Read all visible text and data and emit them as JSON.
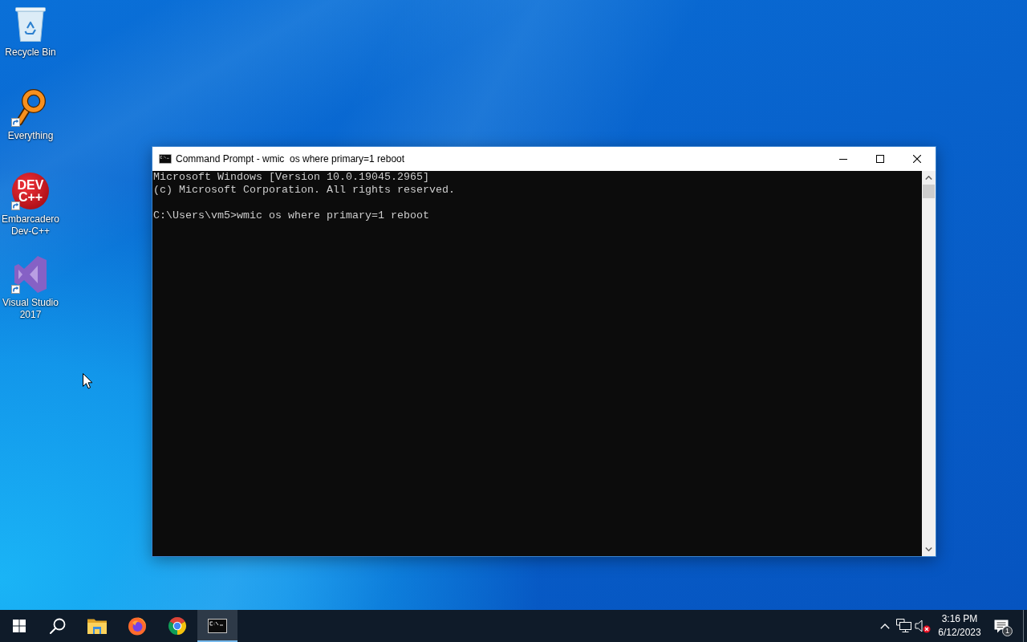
{
  "desktop_icons": [
    {
      "kind": "recycle-bin",
      "label": "Recycle Bin",
      "shortcut": false
    },
    {
      "kind": "magnifier",
      "label": "Everything",
      "shortcut": true
    },
    {
      "kind": "disc-logo",
      "label": "Embarcadero Dev-C++",
      "logo_lines": [
        "DEV",
        "C++"
      ],
      "shortcut": true
    },
    {
      "kind": "visual-studio",
      "label": "Visual Studio 2017",
      "shortcut": true
    }
  ],
  "window": {
    "title": "Command Prompt - wmic  os where primary=1 reboot",
    "console_blocks": [
      [
        "Microsoft Windows [Version 10.0.19045.2965]",
        "(c) Microsoft Corporation. All rights reserved."
      ],
      [
        "C:\\Users\\vm5>wmic os where primary=1 reboot"
      ]
    ]
  },
  "taskbar": {
    "buttons": [
      {
        "kind": "start",
        "active": false
      },
      {
        "kind": "search",
        "active": false
      },
      {
        "kind": "file-explorer",
        "active": false
      },
      {
        "kind": "firefox",
        "active": false
      },
      {
        "kind": "chrome",
        "active": false
      },
      {
        "kind": "terminal",
        "active": true
      }
    ],
    "tray": {
      "icons": [
        {
          "kind": "chevron"
        },
        {
          "kind": "network"
        },
        {
          "kind": "volume",
          "muted": true
        }
      ],
      "time": "3:16 PM",
      "date": "6/12/2023",
      "notification_count": "1"
    }
  }
}
